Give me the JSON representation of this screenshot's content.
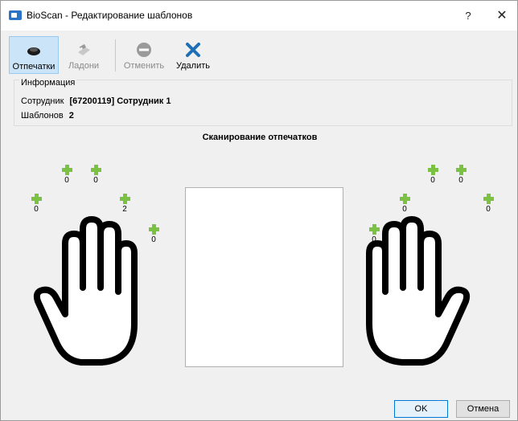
{
  "window": {
    "title": "BioScan - Редактирование шаблонов",
    "help": "?",
    "close": "✕"
  },
  "toolbar": {
    "fingerprints": "Отпечатки",
    "palms": "Ладони",
    "cancel": "Отменить",
    "delete": "Удалить"
  },
  "info": {
    "legend": "Информация",
    "employee_label": "Сотрудник",
    "employee_value": "[67200119] Сотрудник 1",
    "templates_label": "Шаблонов",
    "templates_value": "2"
  },
  "scan": {
    "title": "Сканирование отпечатков"
  },
  "left_hand": {
    "thumb": "0",
    "index": "2",
    "middle": "0",
    "ring": "0",
    "little": "0"
  },
  "right_hand": {
    "thumb": "0",
    "index": "0",
    "middle": "0",
    "ring": "0",
    "little": "0"
  },
  "buttons": {
    "ok": "OK",
    "cancel": "Отмена"
  },
  "colors": {
    "accent": "#2a73c9",
    "plus_green": "#7bc143",
    "delete_blue": "#1f6fb8",
    "active_toolbar": "#cce4f7"
  }
}
